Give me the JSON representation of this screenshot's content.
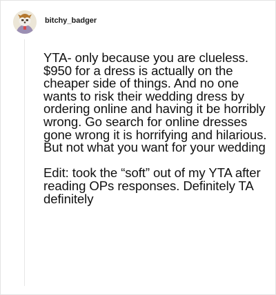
{
  "post": {
    "username": "bitchy_badger",
    "avatar_icon": "badger-avatar-icon",
    "paragraphs": [
      "YTA- only because you are clueless. $950 for a dress is actually on the cheaper side of things. And no one wants to risk their wedding dress by ordering online and having it be horribly wrong. Go search for online dresses gone wrong it is horrifying and hilarious. But not what you want for your wedding",
      "Edit: took the “soft” out of my YTA after reading OPs responses. Definitely TA definitely"
    ]
  }
}
